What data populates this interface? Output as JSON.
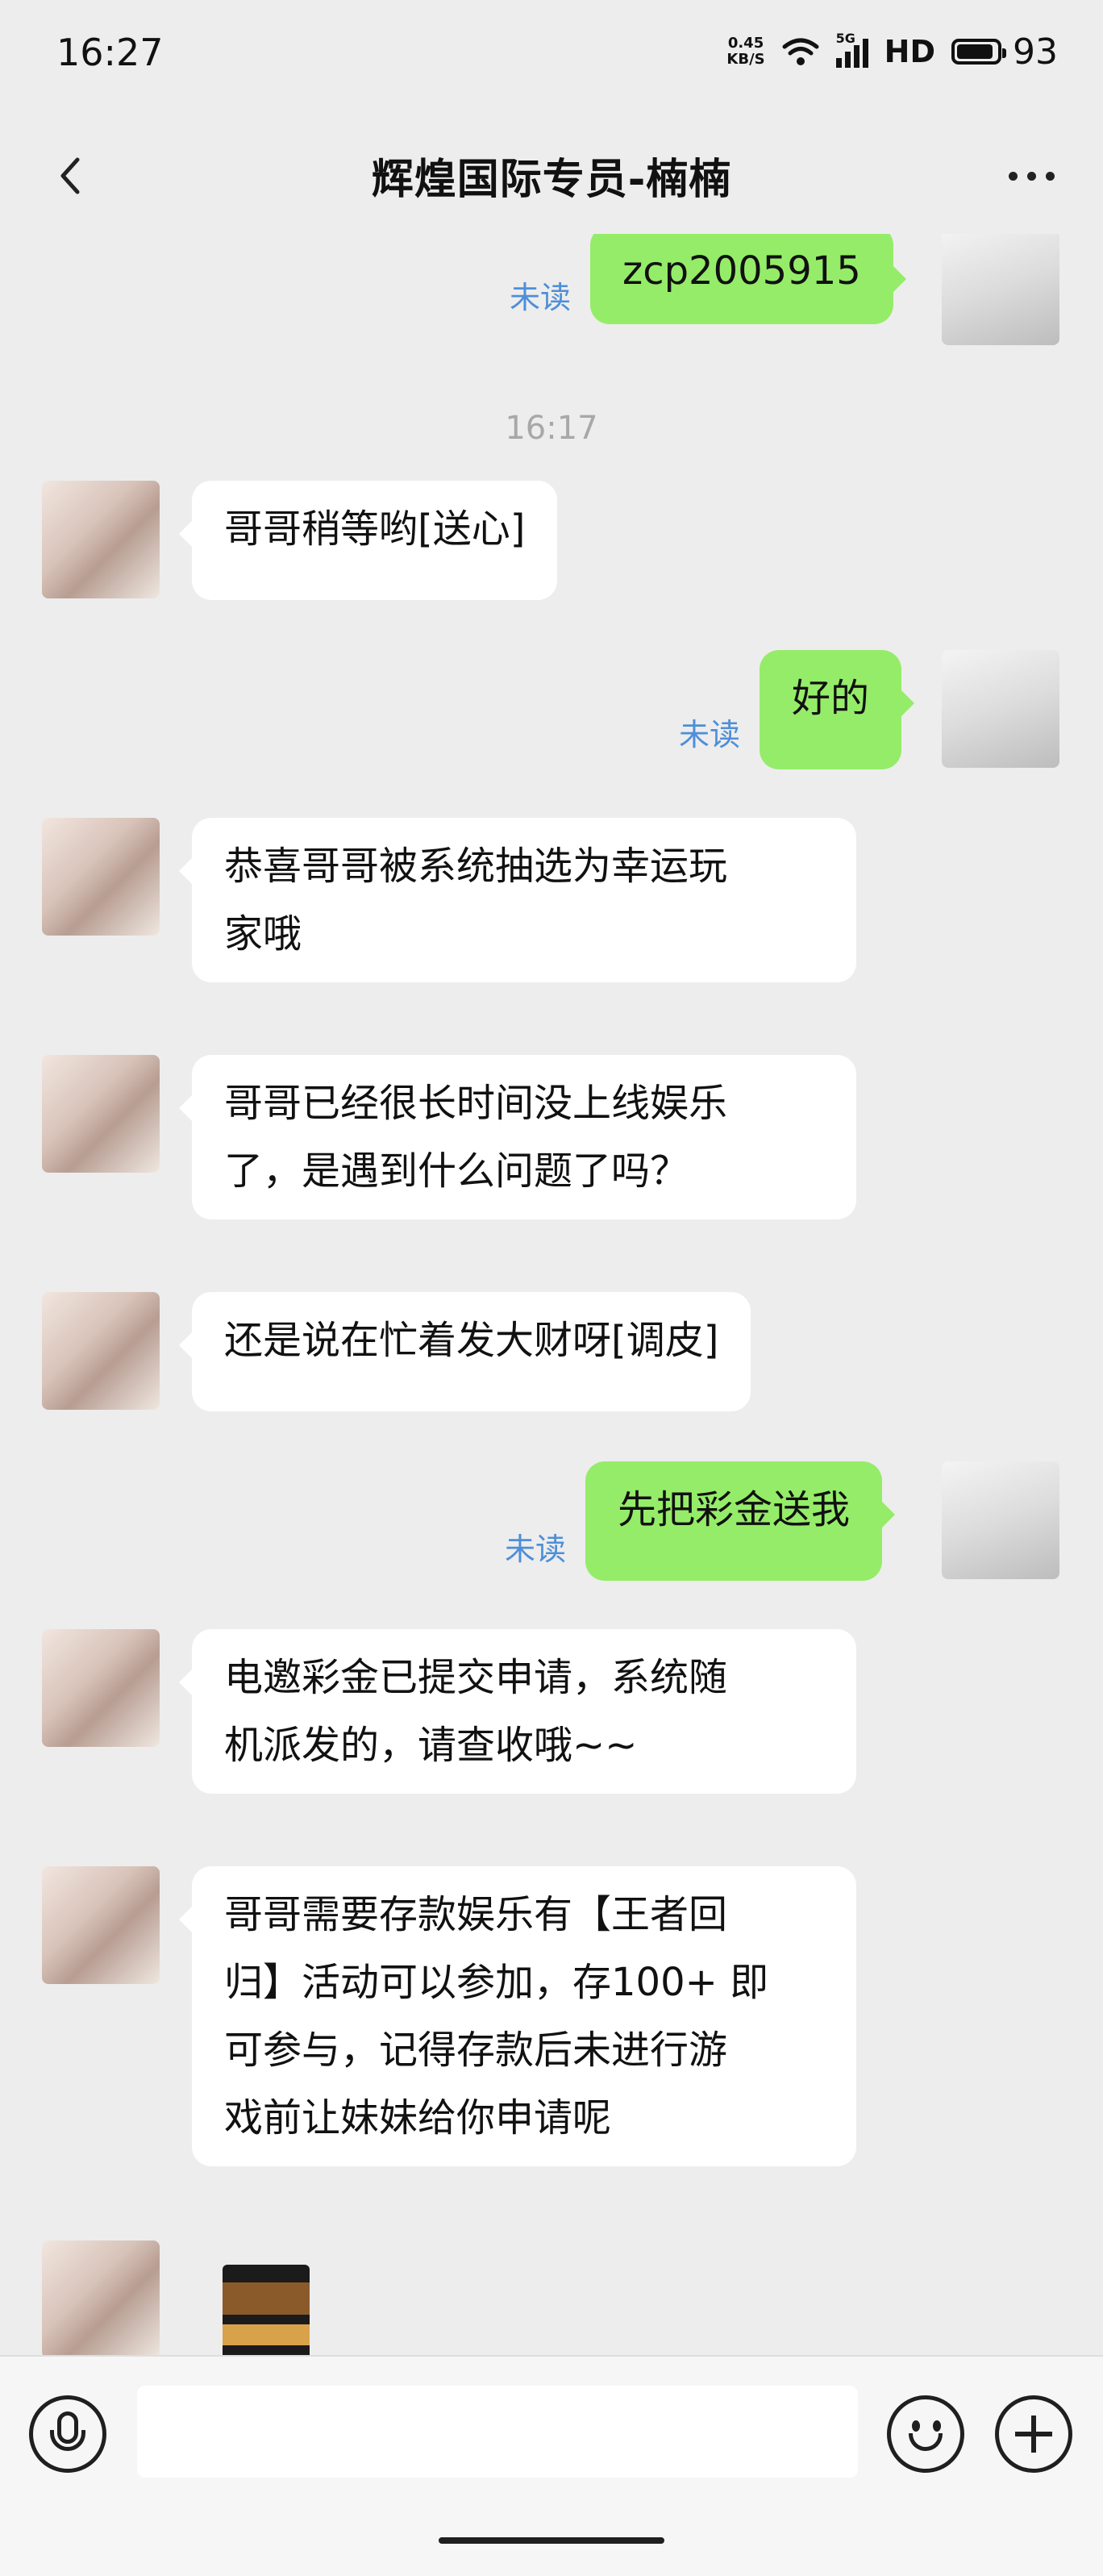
{
  "status_bar": {
    "time": "16:27",
    "net_speed_value": "0.45",
    "net_speed_unit": "KB/S",
    "network": "5G",
    "hd": "HD",
    "battery": "93",
    "battery_level_percent": 93
  },
  "header": {
    "title": "辉煌国际专员-楠楠"
  },
  "messages": [
    {
      "side": "out",
      "text": "zcp2005915",
      "unread": "未读"
    },
    {
      "type": "timestamp",
      "text": "16:17"
    },
    {
      "side": "in",
      "text": "哥哥稍等哟[送心]"
    },
    {
      "side": "out",
      "text": "好的",
      "unread": "未读"
    },
    {
      "side": "in",
      "lines": [
        "恭喜哥哥被系统抽选为幸运玩",
        "家哦"
      ]
    },
    {
      "side": "in",
      "lines": [
        "哥哥已经很长时间没上线娱乐",
        "了，是遇到什么问题了吗？"
      ]
    },
    {
      "side": "in",
      "text": "还是说在忙着发大财呀[调皮]"
    },
    {
      "side": "out",
      "text": "先把彩金送我",
      "unread": "未读"
    },
    {
      "side": "in",
      "lines": [
        "电邀彩金已提交申请，系统随",
        "机派发的，请查收哦~~"
      ]
    },
    {
      "side": "in",
      "lines": [
        "哥哥需要存款娱乐有【王者回",
        "归】活动可以参加，存100+ 即",
        "可参与，记得存款后未进行游",
        "戏前让妹妹给你申请呢"
      ]
    },
    {
      "side": "in",
      "type": "image"
    }
  ],
  "input_bar": {
    "placeholder": ""
  },
  "icons": {
    "back": "back-arrow-icon",
    "more": "more-dots-icon",
    "voice": "microphone-icon",
    "emoji": "emoji-icon",
    "plus": "plus-icon"
  }
}
